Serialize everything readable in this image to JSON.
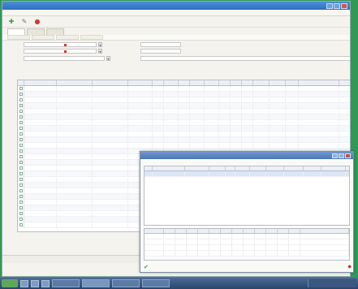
{
  "window": {
    "title": ""
  },
  "menu": {
    "items": [
      "",
      "",
      ""
    ]
  },
  "toolbar": {
    "buttons": [
      {
        "icon": "add-icon"
      },
      {
        "icon": "edit-icon"
      },
      {
        "icon": "delete-icon"
      }
    ]
  },
  "tabs": [
    "",
    "",
    ""
  ],
  "subtabs": [
    "",
    "",
    "",
    ""
  ],
  "filters": [
    {
      "label": "",
      "value": ""
    },
    {
      "label": "",
      "value": ""
    },
    {
      "label": "",
      "value": ""
    },
    {
      "label": "",
      "value": ""
    },
    {
      "label": "",
      "value": ""
    },
    {
      "label": "",
      "value": ""
    }
  ],
  "grid": {
    "columns": [
      "",
      "",
      "",
      "",
      "",
      "",
      "",
      "",
      "",
      "",
      "",
      "",
      "",
      "",
      "",
      "",
      ""
    ],
    "row_count_visible": 25
  },
  "footer": {
    "left_label": "",
    "right_label": ""
  },
  "status": {
    "items": [
      "",
      "",
      "",
      ""
    ]
  },
  "dialog": {
    "title": "",
    "top_grid": {
      "columns": [
        "",
        "",
        "",
        "",
        "",
        "",
        "",
        "",
        "",
        "",
        ""
      ],
      "rows": [
        [
          "",
          "",
          "",
          "",
          "",
          "",
          "",
          "",
          "",
          "",
          ""
        ]
      ]
    },
    "bottom_grid": {
      "columns": [
        "",
        "",
        "",
        "",
        "",
        "",
        "",
        "",
        "",
        "",
        "",
        "",
        "",
        ""
      ],
      "row_count_visible": 4
    }
  },
  "taskbar": {
    "items": [
      "",
      "",
      "",
      ""
    ],
    "clock": ""
  },
  "colors": {
    "desktop": "#2f9a55",
    "titlebar": "#2e6fc0",
    "accent_green": "#3aa04a",
    "accent_red": "#d33a2c"
  }
}
